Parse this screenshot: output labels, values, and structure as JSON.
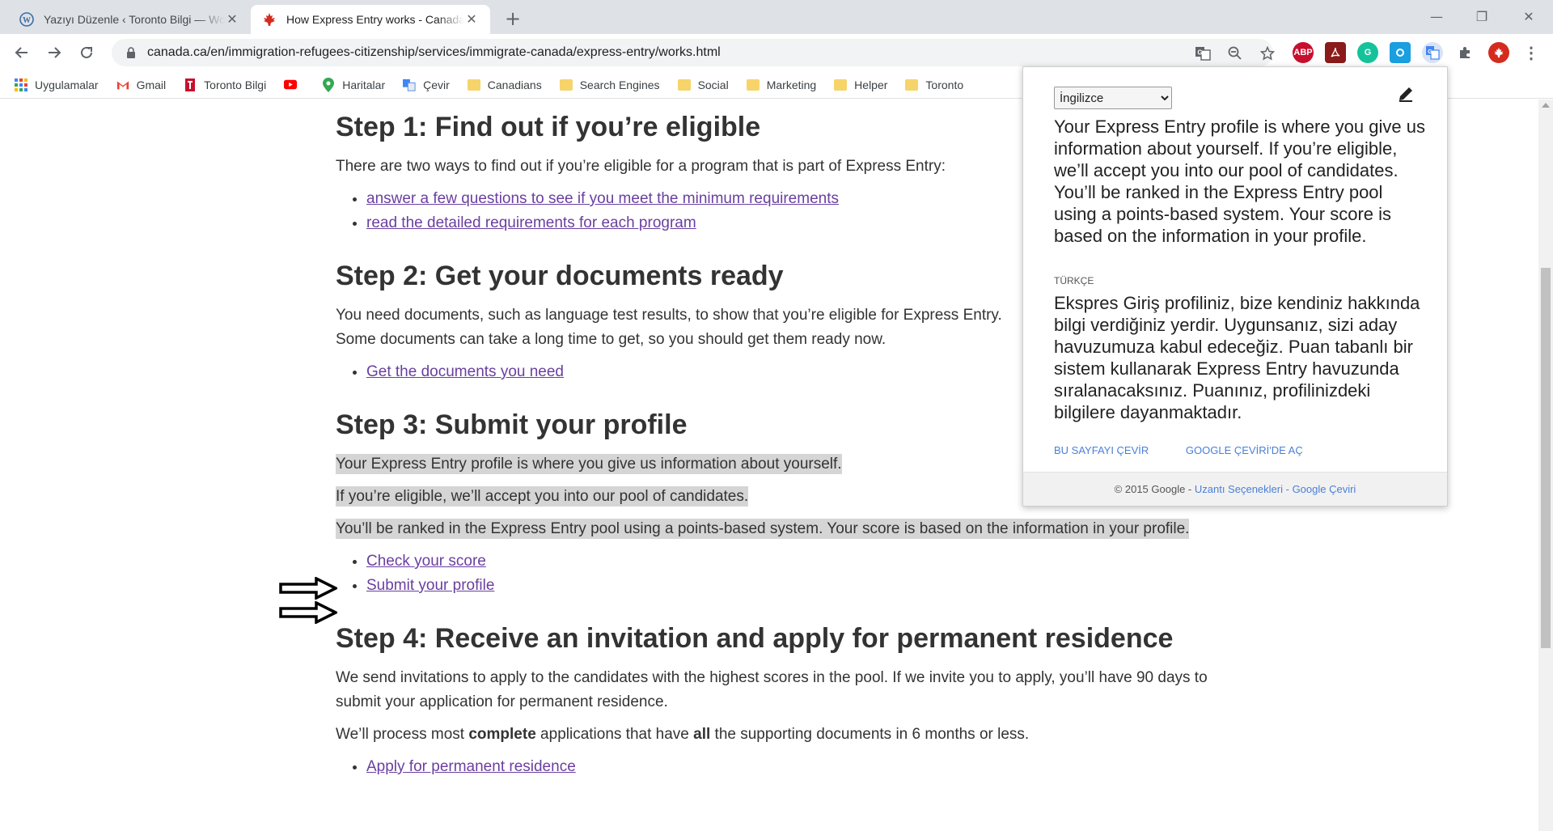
{
  "browser": {
    "tabs": [
      {
        "title": "Yazıyı Düzenle ‹ Toronto Bilgi — WordPress",
        "active": false,
        "icon": "wordpress-icon"
      },
      {
        "title": "How Express Entry works - Canada.ca",
        "active": true,
        "icon": "maple-leaf-icon"
      }
    ],
    "url": "canada.ca/en/immigration-refugees-citizenship/services/immigrate-canada/express-entry/works.html",
    "extensions": [
      "ABP",
      "acrobat",
      "grammarly",
      "screenshot",
      "google-translate",
      "puzzle"
    ]
  },
  "bookmarks": [
    {
      "label": "Uygulamalar",
      "icon": "apps-grid-icon"
    },
    {
      "label": "Gmail",
      "icon": "gmail-icon"
    },
    {
      "label": "Toronto Bilgi",
      "icon": "toronto-bilgi-icon"
    },
    {
      "label": "",
      "icon": "youtube-icon"
    },
    {
      "label": "Haritalar",
      "icon": "maps-pin-icon"
    },
    {
      "label": "Çevir",
      "icon": "translate-icon"
    },
    {
      "label": "Canadians",
      "icon": "folder-icon"
    },
    {
      "label": "Search Engines",
      "icon": "folder-icon"
    },
    {
      "label": "Social",
      "icon": "folder-icon"
    },
    {
      "label": "Marketing",
      "icon": "folder-icon"
    },
    {
      "label": "Helper",
      "icon": "folder-icon"
    },
    {
      "label": "Toronto",
      "icon": "folder-icon"
    }
  ],
  "article": {
    "step1": {
      "heading": "Step 1: Find out if you’re eligible",
      "intro": "There are two ways to find out if you’re eligible for a program that is part of Express Entry:",
      "links": [
        "answer a few questions to see if you meet the minimum requirements",
        "read the detailed requirements for each program"
      ]
    },
    "step2": {
      "heading": "Step 2: Get your documents ready",
      "intro": "You need documents, such as language test results, to show that you’re eligible for Express Entry. Some documents can take a long time to get, so you should get them ready now.",
      "links": [
        "Get the documents you need"
      ]
    },
    "step3": {
      "heading": "Step 3: Submit your profile",
      "p1": "Your Express Entry profile is where you give us information about yourself.",
      "p2": "If you’re eligible, we’ll accept you into our pool of candidates.",
      "p3": "You’ll be ranked in the Express Entry pool using a points-based system. Your score is based on the information in your profile.",
      "links": [
        "Check your score",
        "Submit your profile"
      ]
    },
    "step4": {
      "heading": "Step 4: Receive an invitation and apply for permanent residence",
      "p1": "We send invitations to apply to the candidates with the highest scores in the pool. If we invite you to apply, you’ll have 90 days to submit your application for permanent residence.",
      "p2_a": "We’ll process most ",
      "p2_b": "complete",
      "p2_c": " applications that have ",
      "p2_d": "all",
      "p2_e": " the supporting documents in 6 months or less.",
      "links": [
        "Apply for permanent residence"
      ]
    }
  },
  "translate_popup": {
    "source_language": "İngilizce",
    "source_text": "Your Express Entry profile is where you give us information about yourself. If you’re eligible, we’ll accept you into our pool of candidates. You’ll be ranked in the Express Entry pool using a points-based system. Your score is based on the information in your profile.",
    "target_language_label": "TÜRKÇE",
    "translated_text": "Ekspres Giriş profiliniz, bize kendiniz hakkında bilgi verdiğiniz yerdir. Uygunsanız, sizi aday havuzumuza kabul edeceğiz. Puan tabanlı bir sistem kullanarak Express Entry havuzunda sıralanacaksınız. Puanınız, profilinizdeki bilgilere dayanmaktadır.",
    "action_translate_page": "BU SAYFAYI ÇEVİR",
    "action_open_google": "GOOGLE ÇEVİRİ'DE AÇ",
    "footer_copyright": "© 2015 Google - ",
    "footer_options": "Uzantı Seçenekleri",
    "footer_sep": " - ",
    "footer_google_translate": "Google Çeviri"
  }
}
